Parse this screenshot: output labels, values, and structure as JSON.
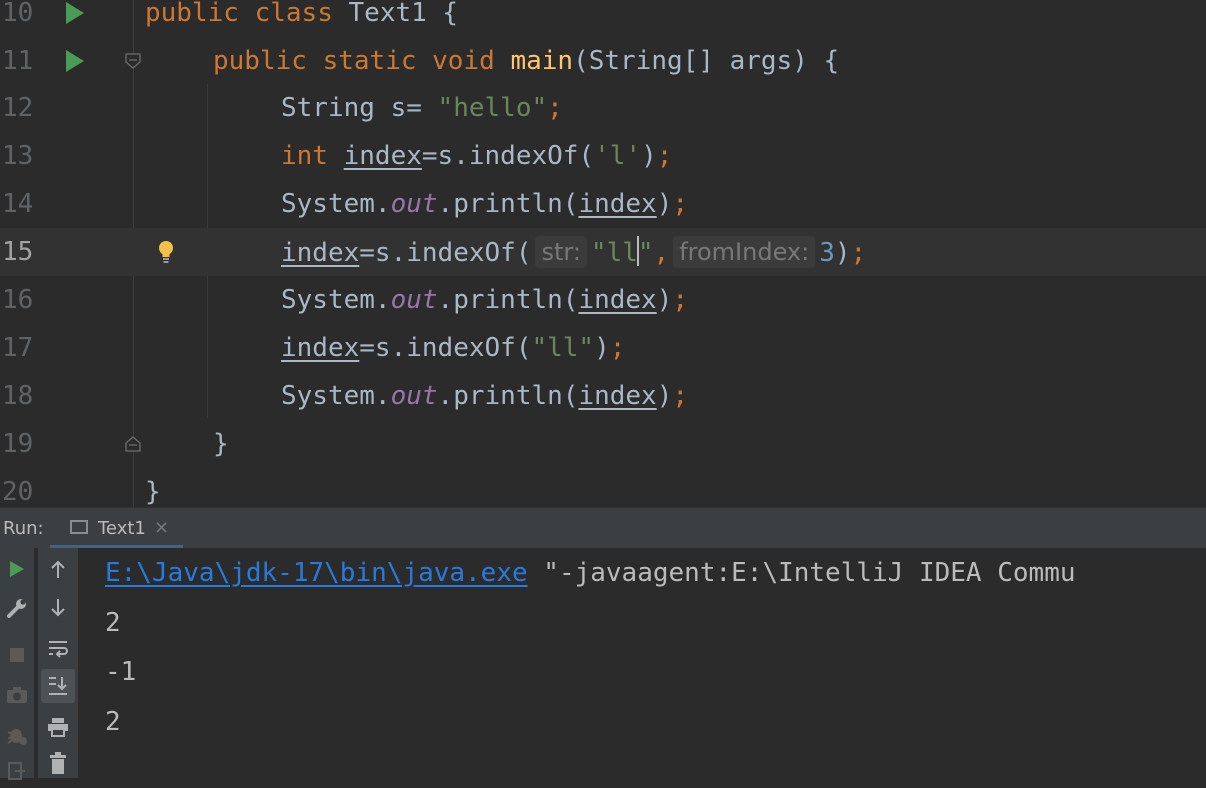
{
  "editor": {
    "current_line": "15",
    "lines": [
      {
        "num": "10",
        "tokens": {
          "a": "public",
          "b": "class",
          "c": "Text1 {"
        }
      },
      {
        "num": "11",
        "tokens": {
          "a": "public",
          "b": "static",
          "c": "void",
          "d": "main",
          "e": "(String[] args) {"
        }
      },
      {
        "num": "12",
        "tokens": {
          "a": "String s= ",
          "b": "\"hello\"",
          "c": ";"
        }
      },
      {
        "num": "13",
        "tokens": {
          "a": "int",
          "b": "index",
          "c": "=s.indexOf(",
          "d": "'l'",
          "e": ")",
          "f": ";"
        }
      },
      {
        "num": "14",
        "tokens": {
          "a": "System.",
          "b": "out",
          "c": ".println(",
          "d": "index",
          "e": ")",
          "f": ";"
        }
      },
      {
        "num": "15",
        "tokens": {
          "a": "index",
          "b": "=s.indexOf(",
          "hint1": "str:",
          "c1": "\"ll",
          "c2": "\"",
          "d": ",",
          "hint2": "fromIndex:",
          "e": "3",
          "f": ")",
          "g": ";"
        }
      },
      {
        "num": "16",
        "tokens": {
          "a": "System.",
          "b": "out",
          "c": ".println(",
          "d": "index",
          "e": ")",
          "f": ";"
        }
      },
      {
        "num": "17",
        "tokens": {
          "a": "index",
          "b": "=s.indexOf(",
          "c": "\"ll\"",
          "d": ")",
          "e": ";"
        }
      },
      {
        "num": "18",
        "tokens": {
          "a": "System.",
          "b": "out",
          "c": ".println(",
          "d": "index",
          "e": ")",
          "f": ";"
        }
      },
      {
        "num": "19",
        "tokens": {
          "a": "}"
        }
      },
      {
        "num": "20",
        "tokens": {
          "a": "}"
        }
      }
    ]
  },
  "run_panel": {
    "label": "Run:",
    "tab_label": "Text1",
    "tab_close": "×"
  },
  "console": {
    "java_path": "E:\\Java\\jdk-17\\bin\\java.exe",
    "command_rest": " \"-javaagent:E:\\IntelliJ IDEA Commu",
    "output": [
      "2",
      "-1",
      "2"
    ]
  },
  "icons": {
    "run": "run-icon",
    "settings": "wrench-icon",
    "stop": "stop-icon",
    "snapshot": "camera-icon",
    "debug": "bug-settings-icon",
    "up": "arrow-up-icon",
    "down": "arrow-down-icon",
    "wrap": "soft-wrap-icon",
    "scroll": "scroll-to-end-icon",
    "print": "print-icon",
    "trash": "trash-icon"
  },
  "colors": {
    "keyword": "#cc7832",
    "string": "#6a8759",
    "method": "#ffc66d",
    "field": "#9876aa",
    "number": "#6897bb",
    "link": "#287bde",
    "run_green": "#499c54"
  }
}
